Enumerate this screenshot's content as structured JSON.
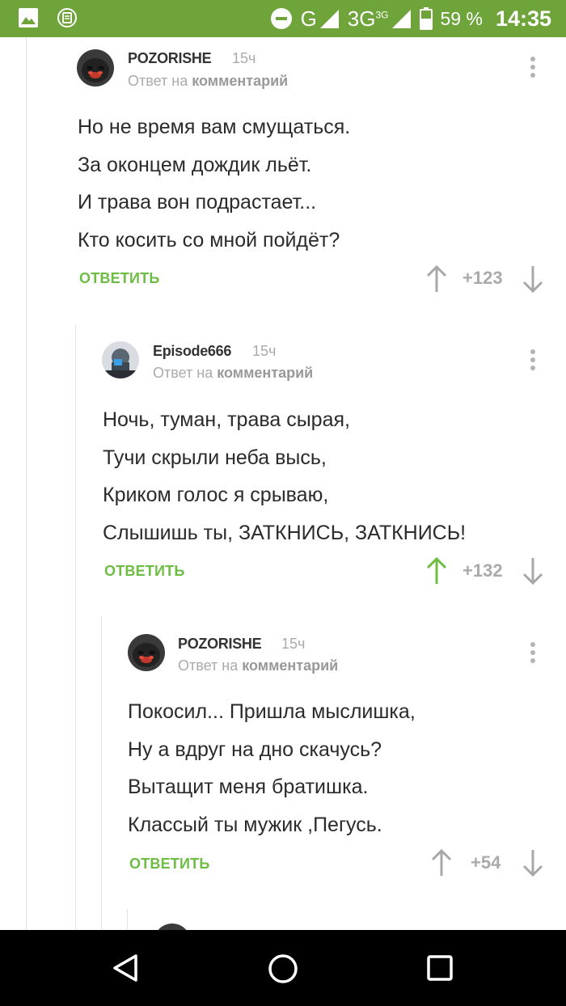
{
  "status_bar": {
    "network_g": "G",
    "network_3g": "3G",
    "network_3g_sup": "3G",
    "battery_percent": "59 %",
    "time": "14:35"
  },
  "reply_to_prefix": "Ответ на",
  "reply_to_target": "комментарий",
  "reply_label": "ОТВЕТИТЬ",
  "comments": [
    {
      "author": "POZORISHE",
      "time": "15ч",
      "lines": [
        "Но не время вам смущаться.",
        "За оконцем дождик льёт.",
        "И трава вон подрастает...",
        "Кто косить со мной пойдёт?"
      ],
      "rating": "+123",
      "upvoted": false
    },
    {
      "author": "Episode666",
      "time": "15ч",
      "lines": [
        "Ночь, туман, трава сырая,",
        "Тучи скрыли неба высь,",
        "Криком голос я срываю,",
        "Слышишь ты, ЗАТКНИСЬ, ЗАТКНИСЬ!"
      ],
      "rating": "+132",
      "upvoted": true
    },
    {
      "author": "POZORISHE",
      "time": "15ч",
      "lines": [
        "Покосил... Пришла мыслишка,",
        "Ну а вдруг на дно скачусь?",
        "Вытащит меня братишка.",
        "Классый ты мужик ,Пегусь."
      ],
      "rating": "+54",
      "upvoted": false
    }
  ],
  "colors": {
    "status_bar": "#6ea43a",
    "accent_green": "#6dbd45",
    "text": "#2b2b2b",
    "muted": "#aaaaaa"
  },
  "icons": {
    "status_left": [
      "gallery-icon",
      "app-notification-icon"
    ],
    "status_right": [
      "do-not-disturb-icon",
      "signal-icon",
      "battery-icon"
    ],
    "navigation": [
      "back-icon",
      "home-icon",
      "recents-icon"
    ]
  }
}
